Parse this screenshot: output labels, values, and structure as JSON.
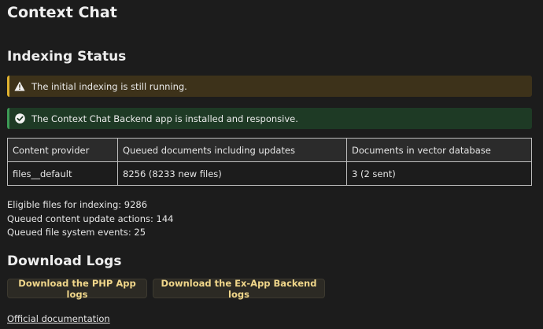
{
  "app": {
    "title": "Context Chat"
  },
  "indexing": {
    "heading": "Indexing Status",
    "warning_text": "The initial indexing is still running.",
    "success_text": "The Context Chat Backend app is installed and responsive."
  },
  "table": {
    "headers": [
      "Content provider",
      "Queued documents including updates",
      "Documents in vector database"
    ],
    "rows": [
      [
        "files__default",
        "8256 (8233 new files)",
        "3 (2 sent)"
      ]
    ]
  },
  "stats": {
    "eligible": "Eligible files for indexing: 9286",
    "queued_actions": "Queued content update actions: 144",
    "queued_events": "Queued file system events: 25"
  },
  "logs": {
    "heading": "Download Logs",
    "php_button": "Download the PHP App logs",
    "exapp_button": "Download the Ex-App Backend logs"
  },
  "footer": {
    "doc_link": "Official documentation"
  },
  "colors": {
    "warning_accent": "#e0b230",
    "success_accent": "#3d9a55",
    "button_text": "#f0d68a"
  },
  "icons": {
    "warning": "warning-triangle-icon",
    "success": "check-circle-icon"
  }
}
